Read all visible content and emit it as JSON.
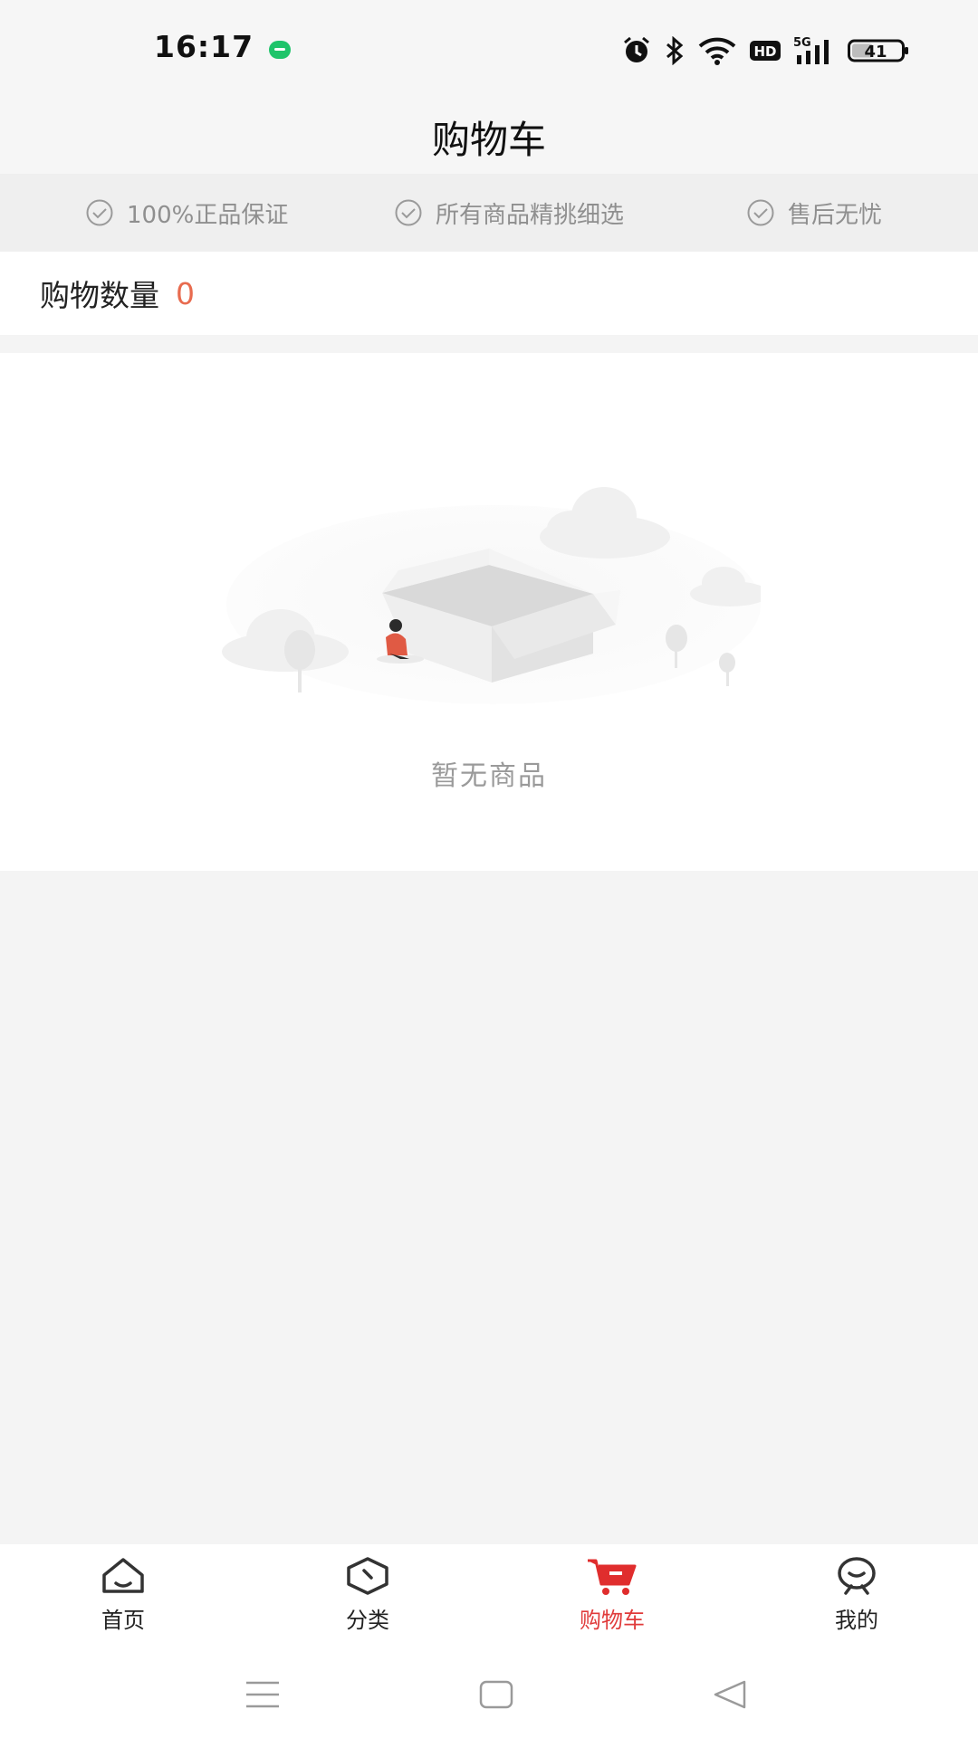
{
  "status_bar": {
    "time": "16:17",
    "battery": "41",
    "network": "5G",
    "hd_label": "HD",
    "icons": [
      "alarm-icon",
      "bluetooth-icon",
      "wifi-icon",
      "hd-icon",
      "signal-icon",
      "battery-icon"
    ]
  },
  "header": {
    "title": "购物车"
  },
  "guarantees": [
    {
      "icon": "check-circle-icon",
      "label": "100%正品保证"
    },
    {
      "icon": "check-circle-icon",
      "label": "所有商品精挑细选"
    },
    {
      "icon": "check-circle-icon",
      "label": "售后无忧"
    }
  ],
  "cart": {
    "count_label": "购物数量",
    "count_value": "0",
    "empty_text": "暂无商品"
  },
  "tabbar": {
    "tabs": [
      {
        "icon": "home-icon",
        "label": "首页",
        "active": false
      },
      {
        "icon": "category-icon",
        "label": "分类",
        "active": false
      },
      {
        "icon": "cart-icon",
        "label": "购物车",
        "active": true
      },
      {
        "icon": "profile-icon",
        "label": "我的",
        "active": false
      }
    ]
  },
  "nav": {
    "buttons": [
      "menu-icon",
      "home-square-icon",
      "back-triangle-icon"
    ]
  },
  "colors": {
    "accent": "#e03b3b",
    "count": "#e86b4f",
    "muted": "#9a9a9a"
  }
}
